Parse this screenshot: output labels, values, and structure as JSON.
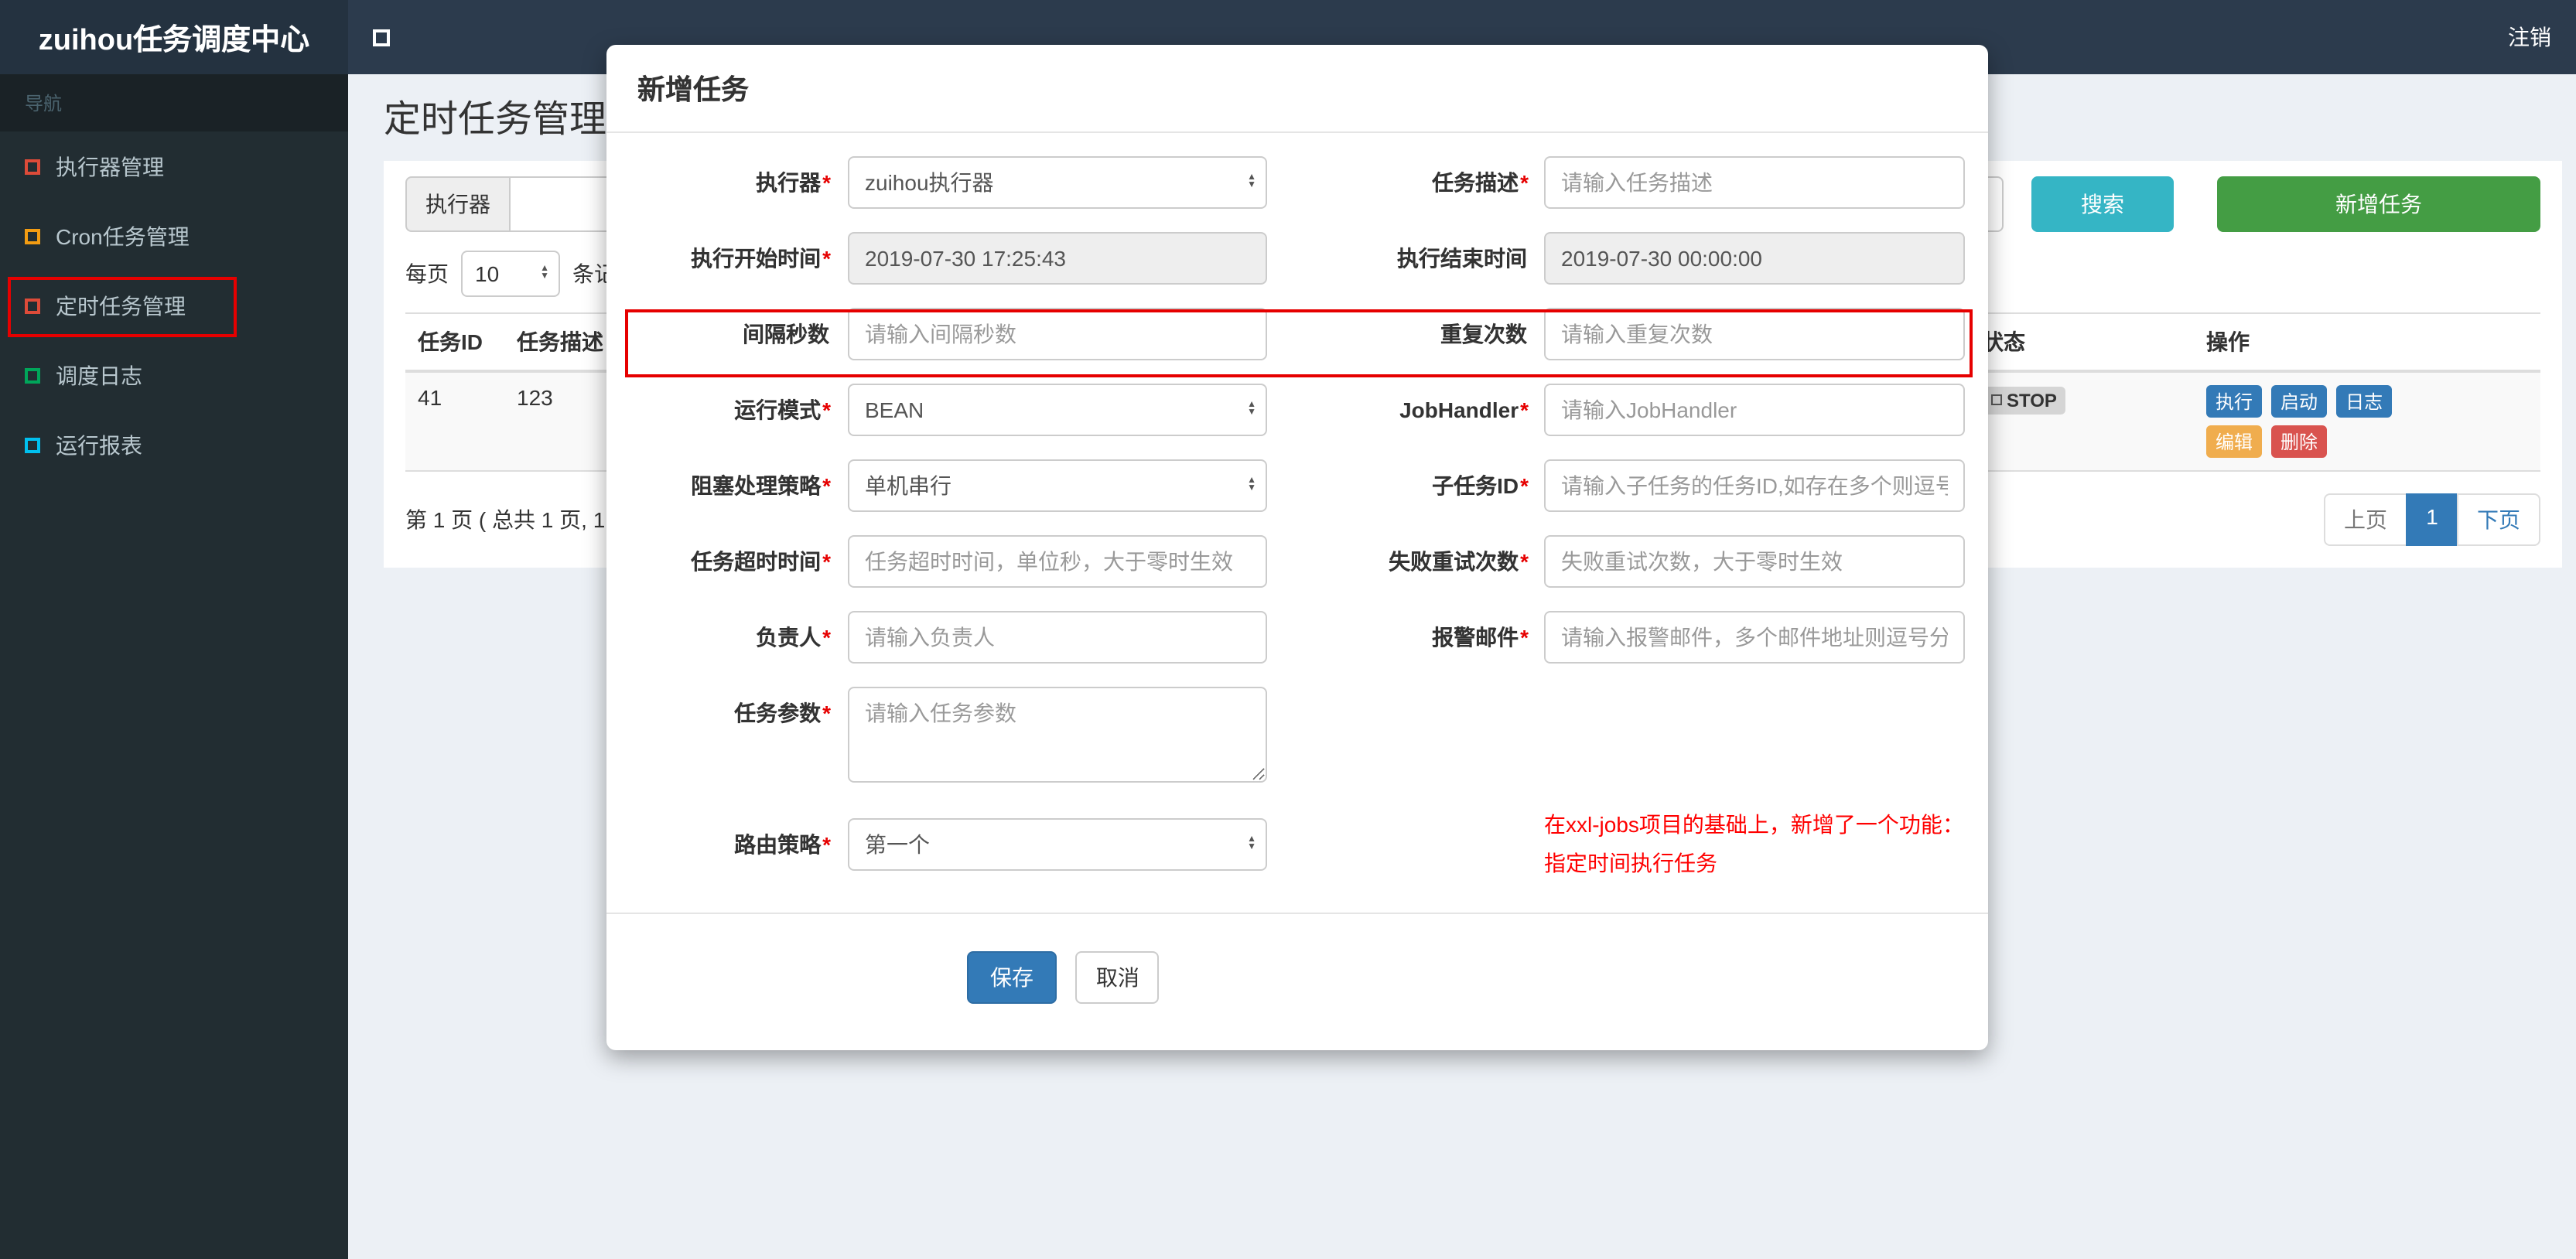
{
  "colors": {
    "header_bg": "#2c3b4d",
    "brand_bg": "#243240",
    "sidebar_bg": "#222d32",
    "content_bg": "#ecf0f5",
    "primary_blue": "#337ab7",
    "search_teal": "#35b5c5",
    "add_green": "#449d44",
    "warning_orange": "#f0ad4e",
    "danger_red": "#d9534f",
    "annotation_red": "#e60000",
    "note_red": "#ff0000",
    "status_badge_bg": "#d5d5d5"
  },
  "header": {
    "brand": "zuihou任务调度中心",
    "logout": "注销"
  },
  "sidebar": {
    "section": "导航",
    "items": [
      {
        "label": "执行器管理",
        "icon_color": "#dd4b39"
      },
      {
        "label": "Cron任务管理",
        "icon_color": "#f39c12"
      },
      {
        "label": "定时任务管理",
        "icon_color": "#dd4b39"
      },
      {
        "label": "调度日志",
        "icon_color": "#00a65a"
      },
      {
        "label": "运行报表",
        "icon_color": "#00c0ef"
      }
    ]
  },
  "page": {
    "title": "定时任务管理",
    "filter": {
      "executor_addon": "执行器",
      "search": "搜索",
      "add_task": "新增任务"
    },
    "per_page": {
      "prefix": "每页",
      "value": "10",
      "suffix": "条记录"
    },
    "table": {
      "headers": [
        "任务ID",
        "任务描述",
        "状态",
        "操作"
      ],
      "row": {
        "job_id": "41",
        "job_desc": "123",
        "status": "STOP",
        "actions": [
          {
            "label": "执行"
          },
          {
            "label": "启动"
          },
          {
            "label": "日志"
          },
          {
            "label": "编辑"
          },
          {
            "label": "删除"
          }
        ]
      }
    },
    "pagination": {
      "summary": "第 1 页 ( 总共 1 页, 1",
      "prev": "上页",
      "page": "1",
      "next": "下页"
    }
  },
  "modal": {
    "title": "新增任务",
    "fields": {
      "executor": {
        "label": "执行器",
        "req": "*",
        "value": "zuihou执行器"
      },
      "job_desc": {
        "label": "任务描述",
        "req": "*",
        "placeholder": "请输入任务描述"
      },
      "start_time": {
        "label": "执行开始时间",
        "req": "*",
        "value": "2019-07-30 17:25:43"
      },
      "end_time": {
        "label": "执行结束时间",
        "req": "",
        "value": "2019-07-30 00:00:00"
      },
      "interval_seconds": {
        "label": "间隔秒数",
        "req": "",
        "placeholder": "请输入间隔秒数"
      },
      "repeat_count": {
        "label": "重复次数",
        "req": "",
        "placeholder": "请输入重复次数"
      },
      "run_mode": {
        "label": "运行模式",
        "req": "*",
        "value": "BEAN"
      },
      "job_handler": {
        "label": "JobHandler",
        "req": "*",
        "placeholder": "请输入JobHandler"
      },
      "block_strategy": {
        "label": "阻塞处理策略",
        "req": "*",
        "value": "单机串行"
      },
      "child_job_id": {
        "label": "子任务ID",
        "req": "*",
        "placeholder": "请输入子任务的任务ID,如存在多个则逗号分隔"
      },
      "timeout": {
        "label": "任务超时时间",
        "req": "*",
        "placeholder": "任务超时时间，单位秒，大于零时生效"
      },
      "fail_retry": {
        "label": "失败重试次数",
        "req": "*",
        "placeholder": "失败重试次数，大于零时生效"
      },
      "owner": {
        "label": "负责人",
        "req": "*",
        "placeholder": "请输入负责人"
      },
      "alarm_email": {
        "label": "报警邮件",
        "req": "*",
        "placeholder": "请输入报警邮件，多个邮件地址则逗号分隔"
      },
      "job_param": {
        "label": "任务参数",
        "req": "*",
        "placeholder": "请输入任务参数"
      },
      "route_strategy": {
        "label": "路由策略",
        "req": "*",
        "value": "第一个"
      }
    },
    "note": "在xxl-jobs项目的基础上，新增了一个功能：指定时间执行任务",
    "save": "保存",
    "cancel": "取消"
  }
}
